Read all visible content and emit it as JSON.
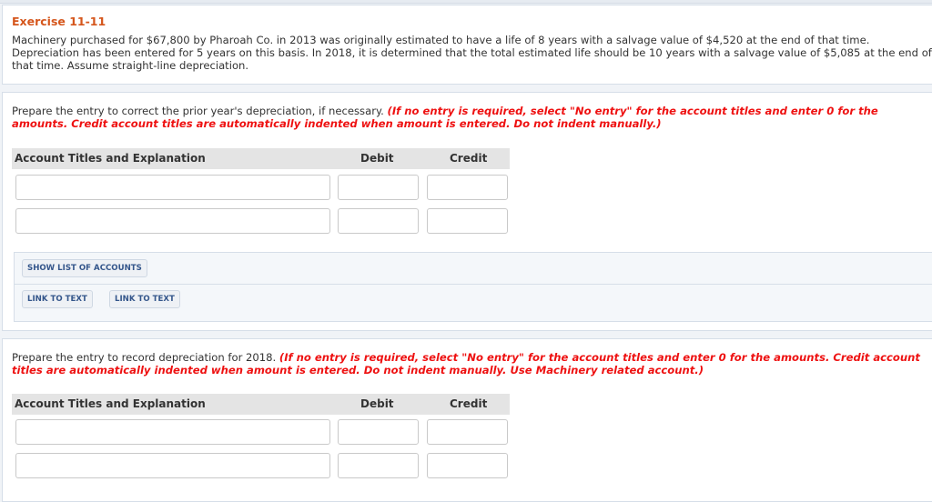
{
  "exercise": {
    "title": "Exercise 11-11",
    "body": "Machinery purchased for $67,800 by Pharoah Co. in 2013 was originally estimated to have a life of 8 years with a salvage value of $4,520 at the end of that time. Depreciation has been entered for 5 years on this basis. In 2018, it is determined that the total estimated life should be 10 years with a salvage value of $5,085 at the end of that time. Assume straight-line depreciation."
  },
  "part1": {
    "prompt": "Prepare the entry to correct the prior year's depreciation, if necessary.",
    "instruction": "(If no entry is required, select \"No entry\" for the account titles and enter 0 for the amounts. Credit account titles are automatically indented when amount is entered. Do not indent manually.)",
    "columns": {
      "account": "Account Titles and Explanation",
      "debit": "Debit",
      "credit": "Credit"
    },
    "rows": [
      {
        "account": "",
        "debit": "",
        "credit": ""
      },
      {
        "account": "",
        "debit": "",
        "credit": ""
      }
    ],
    "buttons": {
      "show_accounts": "SHOW LIST OF ACCOUNTS",
      "link_text_1": "LINK TO TEXT",
      "link_text_2": "LINK TO TEXT"
    }
  },
  "part2": {
    "prompt": "Prepare the entry to record depreciation for 2018.",
    "instruction": "(If no entry is required, select \"No entry\" for the account titles and enter 0 for the amounts. Credit account titles are automatically indented when amount is entered. Do not indent manually. Use Machinery related account.)",
    "columns": {
      "account": "Account Titles and Explanation",
      "debit": "Debit",
      "credit": "Credit"
    },
    "rows": [
      {
        "account": "",
        "debit": "",
        "credit": ""
      },
      {
        "account": "",
        "debit": "",
        "credit": ""
      }
    ]
  },
  "colors": {
    "title": "#d5561c",
    "warning": "#ee1111",
    "button_text": "#34568b",
    "header_bg": "#e4e4e4"
  }
}
